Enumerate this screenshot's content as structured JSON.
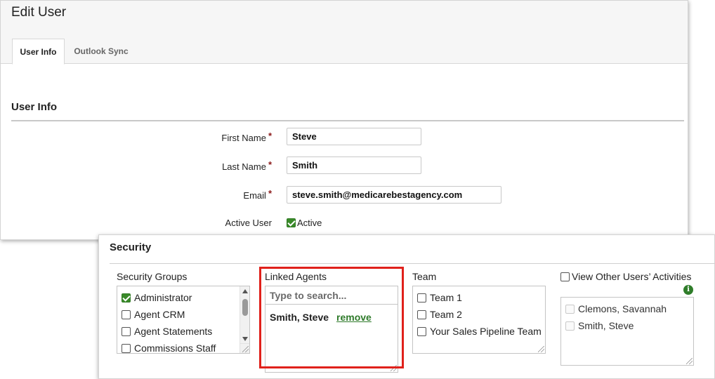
{
  "header": {
    "title": "Edit User",
    "tabs": [
      {
        "label": "User Info",
        "active": true
      },
      {
        "label": "Outlook Sync",
        "active": false
      }
    ]
  },
  "user_info": {
    "heading": "User Info",
    "first_name": {
      "label": "First Name",
      "required_mark": "*",
      "value": "Steve"
    },
    "last_name": {
      "label": "Last Name",
      "required_mark": "*",
      "value": "Smith"
    },
    "email": {
      "label": "Email",
      "required_mark": "*",
      "value": "steve.smith@medicarebestagency.com"
    },
    "active_user": {
      "label": "Active User",
      "checkbox_label": "Active",
      "checked": true
    }
  },
  "security": {
    "heading": "Security",
    "security_groups": {
      "label": "Security Groups",
      "items": [
        {
          "label": "Administrator",
          "checked": true
        },
        {
          "label": "Agent CRM",
          "checked": false
        },
        {
          "label": "Agent Statements",
          "checked": false
        },
        {
          "label": "Commissions Staff",
          "checked": false
        }
      ]
    },
    "linked_agents": {
      "label": "Linked Agents",
      "search_placeholder": "Type to search...",
      "agents": [
        {
          "name": "Smith, Steve",
          "action": "remove"
        }
      ],
      "highlight_color": "#e0211b"
    },
    "team": {
      "label": "Team",
      "items": [
        {
          "label": "Team 1",
          "checked": false
        },
        {
          "label": "Team 2",
          "checked": false
        },
        {
          "label": "Your Sales Pipeline Team",
          "checked": false
        }
      ]
    },
    "view_other_users": {
      "label": "View Other Users’ Activities",
      "checked": false,
      "info_icon": "info-icon",
      "users": [
        {
          "label": "Clemons, Savannah",
          "checked": false,
          "disabled": true
        },
        {
          "label": "Smith, Steve",
          "checked": false,
          "disabled": true
        }
      ]
    }
  },
  "colors": {
    "accent_green": "#3a8a2a",
    "required_red": "#8b1a1a"
  }
}
